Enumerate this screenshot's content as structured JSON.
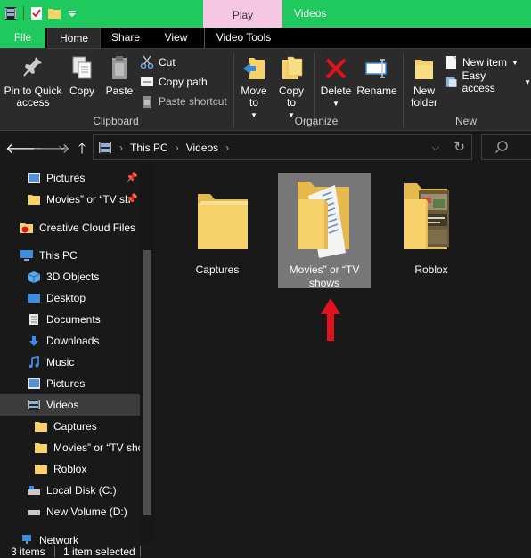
{
  "titlebar": {
    "play_tab": "Play",
    "window_title": "Videos"
  },
  "tabs": {
    "file": "File",
    "home": "Home",
    "share": "Share",
    "view": "View",
    "video_tools": "Video Tools"
  },
  "ribbon": {
    "pin_quick_access": "Pin to Quick access",
    "copy": "Copy",
    "paste": "Paste",
    "cut": "Cut",
    "copy_path": "Copy path",
    "paste_shortcut": "Paste shortcut",
    "clipboard_label": "Clipboard",
    "move_to": "Move to",
    "copy_to": "Copy to",
    "delete": "Delete",
    "rename": "Rename",
    "organize_label": "Organize",
    "new_folder": "New folder",
    "new_item": "New item",
    "easy_access": "Easy access",
    "new_label": "New"
  },
  "address": {
    "crumb_1": "This PC",
    "crumb_2": "Videos"
  },
  "nav": {
    "items": [
      {
        "label": "Pictures",
        "icon": "pictures-icon",
        "pinned": true
      },
      {
        "label": "Movies” or “TV sh",
        "icon": "folder-icon",
        "pinned": true
      },
      {
        "label": "Creative Cloud Files",
        "icon": "creative-cloud-icon"
      },
      {
        "label": "This PC",
        "icon": "this-pc-icon"
      },
      {
        "label": "3D Objects",
        "icon": "3d-objects-icon"
      },
      {
        "label": "Desktop",
        "icon": "desktop-icon"
      },
      {
        "label": "Documents",
        "icon": "documents-icon"
      },
      {
        "label": "Downloads",
        "icon": "downloads-icon"
      },
      {
        "label": "Music",
        "icon": "music-icon"
      },
      {
        "label": "Pictures",
        "icon": "pictures-icon"
      },
      {
        "label": "Videos",
        "icon": "videos-icon",
        "selected": true
      },
      {
        "label": "Captures",
        "icon": "folder-icon"
      },
      {
        "label": "Movies” or “TV shc",
        "icon": "folder-icon"
      },
      {
        "label": "Roblox",
        "icon": "folder-icon"
      },
      {
        "label": "Local Disk (C:)",
        "icon": "local-disk-icon"
      },
      {
        "label": "New Volume (D:)",
        "icon": "drive-icon"
      },
      {
        "label": "Network",
        "icon": "network-icon"
      }
    ]
  },
  "files": [
    {
      "name": "Captures",
      "icon": "folder-icon"
    },
    {
      "name": "Movies” or “TV shows",
      "icon": "folder-documents-icon",
      "selected": true
    },
    {
      "name": "Roblox",
      "icon": "folder-video-thumbnail-icon"
    }
  ],
  "status": {
    "item_count": "3 items",
    "selection": "1 item selected"
  },
  "colors": {
    "titlebar_green": "#1fc95e",
    "play_tab_pink": "#f6c7e2",
    "folder_yellow": "#f7d26a",
    "annotation_arrow_red": "#e0121b",
    "selected_item_gray": "#777777"
  }
}
